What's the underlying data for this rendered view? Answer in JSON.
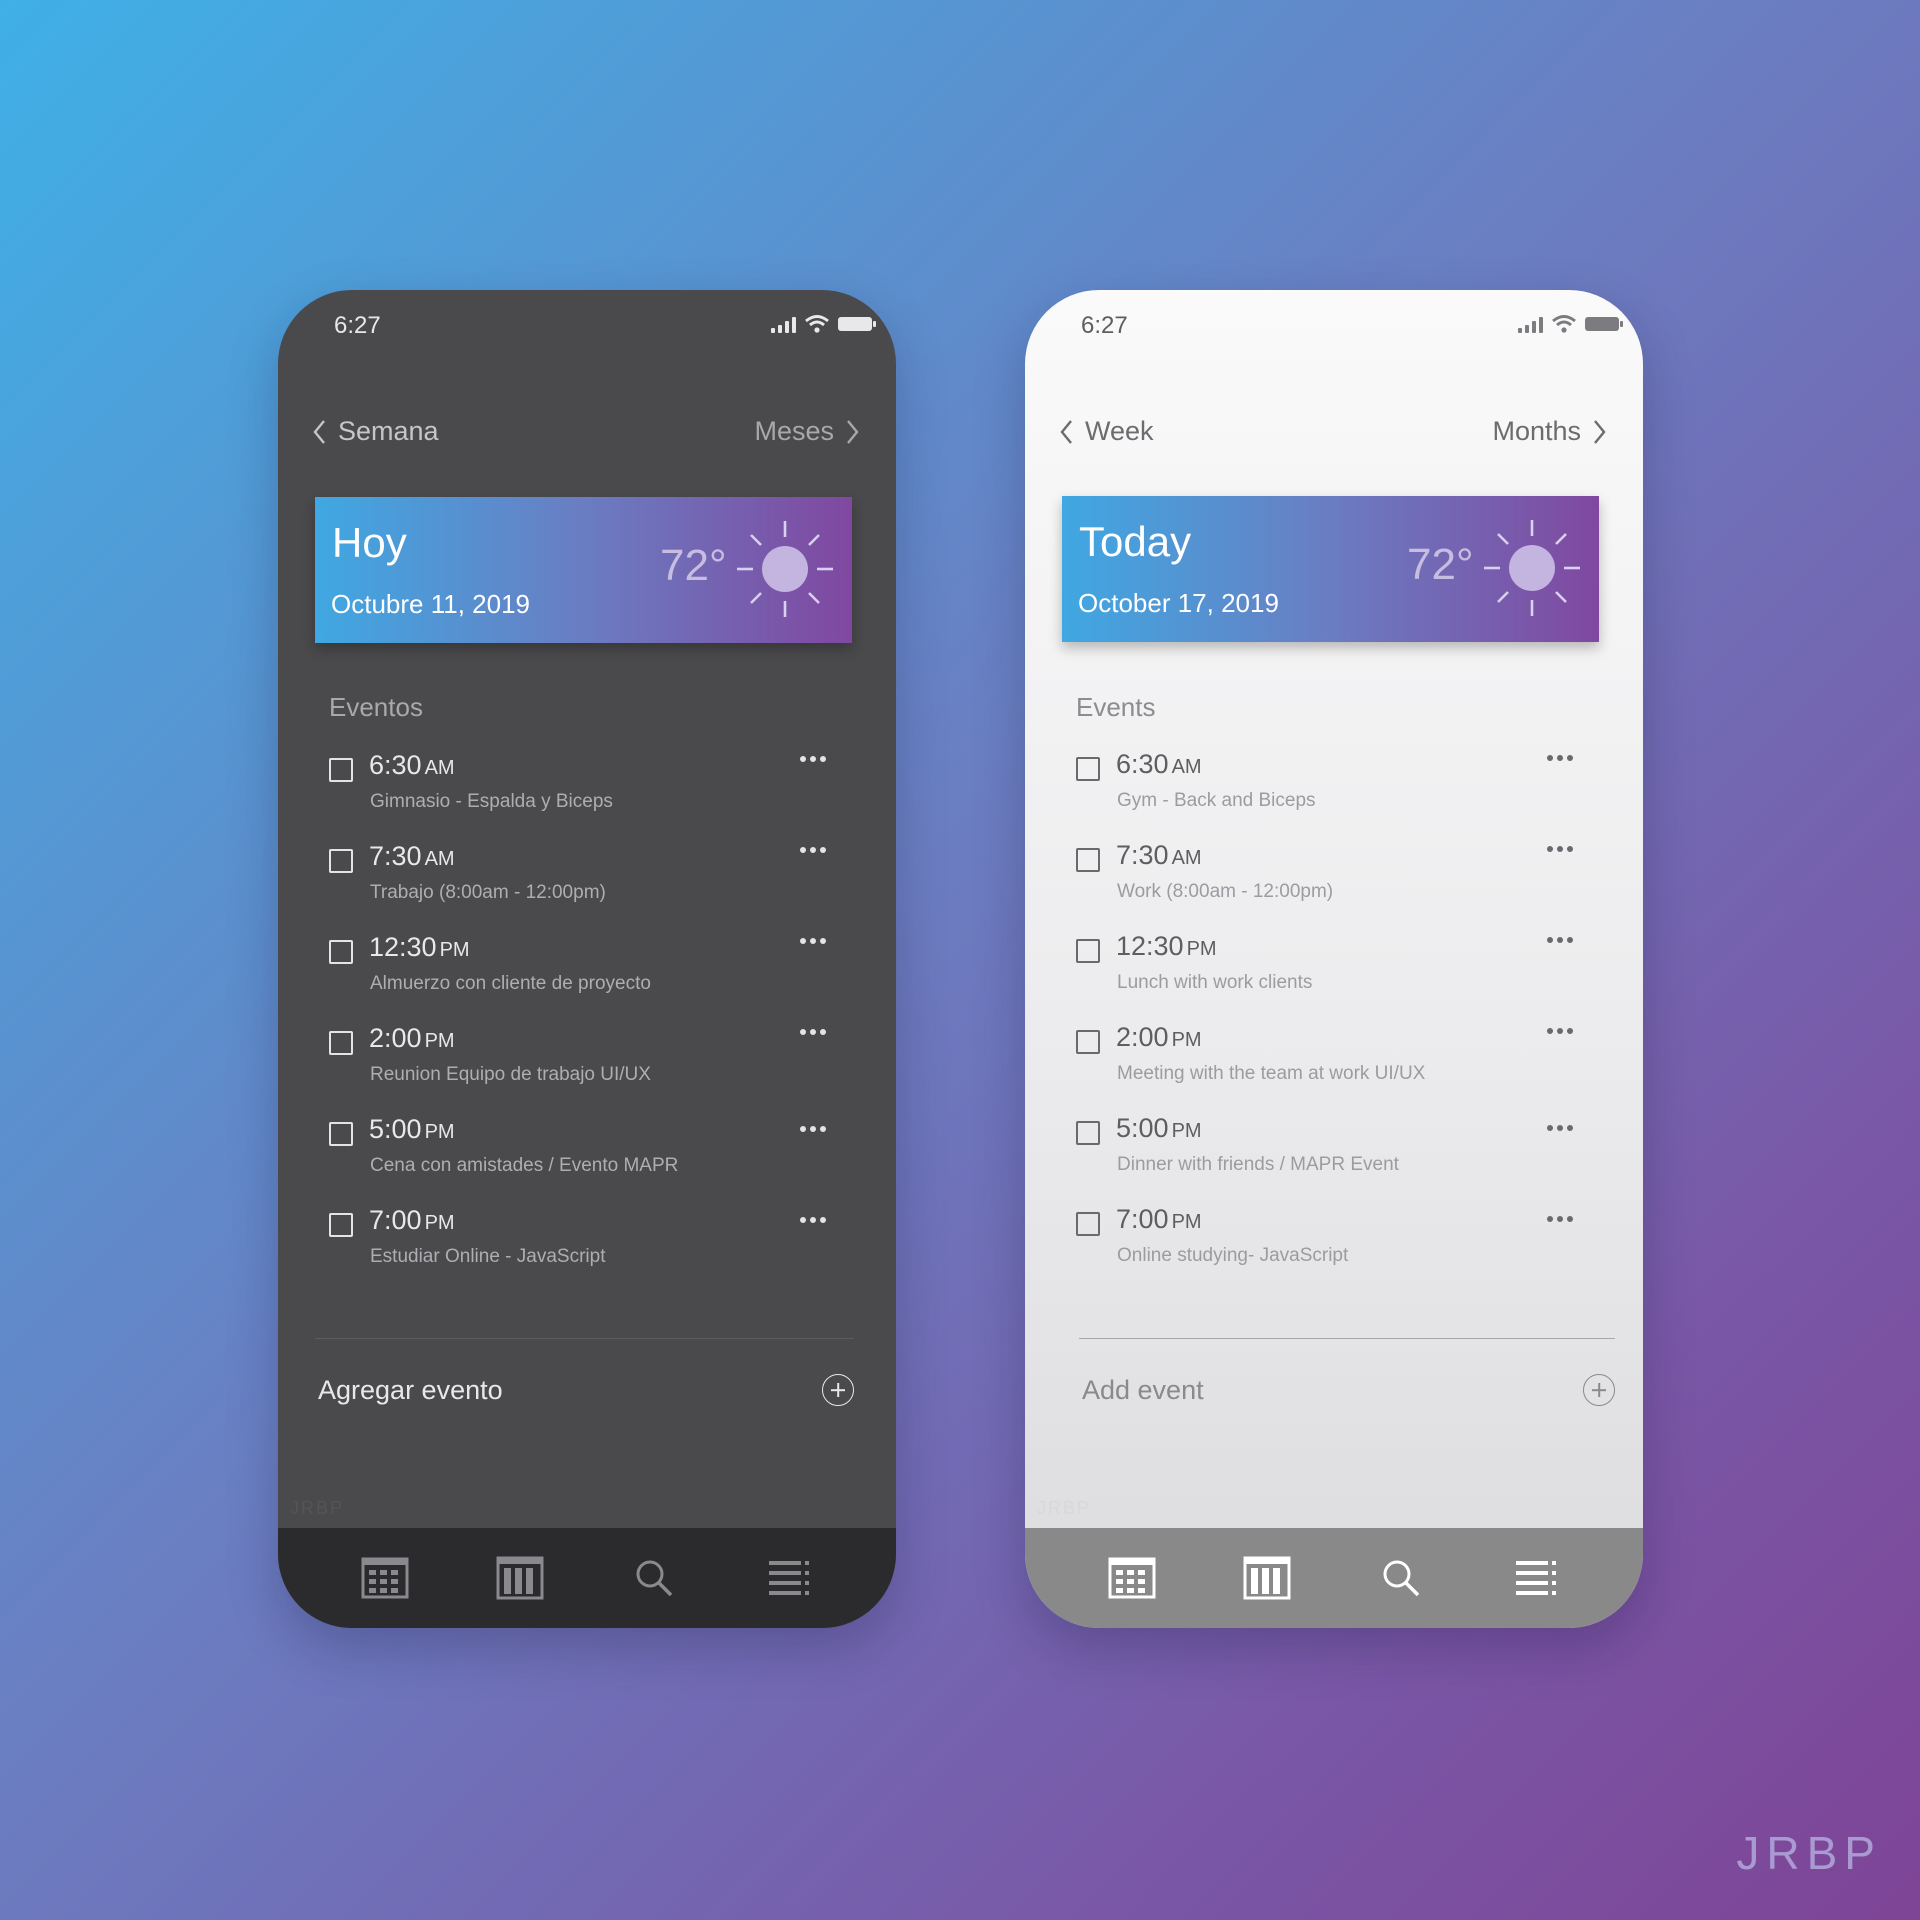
{
  "watermark": "JRBP",
  "phones": [
    {
      "theme": "dark",
      "status_time": "6:27",
      "nav": {
        "back_label": "Semana",
        "forward_label": "Meses"
      },
      "today": {
        "title": "Hoy",
        "date": "Octubre 11, 2019",
        "temperature": "72°",
        "weather_icon": "sun-icon"
      },
      "events_label": "Eventos",
      "events": [
        {
          "time": "6:30",
          "ampm": "AM",
          "desc": "Gimnasio - Espalda y Biceps"
        },
        {
          "time": "7:30",
          "ampm": "AM",
          "desc": "Trabajo (8:00am - 12:00pm)"
        },
        {
          "time": "12:30",
          "ampm": "PM",
          "desc": "Almuerzo con cliente de proyecto"
        },
        {
          "time": "2:00",
          "ampm": "PM",
          "desc": "Reunion Equipo de trabajo UI/UX"
        },
        {
          "time": "5:00",
          "ampm": "PM",
          "desc": "Cena con amistades / Evento MAPR"
        },
        {
          "time": "7:00",
          "ampm": "PM",
          "desc": "Estudiar Online - JavaScript"
        }
      ],
      "add_event_label": "Agregar evento",
      "tabs": [
        "month-grid-icon",
        "week-columns-icon",
        "search-icon",
        "list-icon"
      ]
    },
    {
      "theme": "light",
      "status_time": "6:27",
      "nav": {
        "back_label": "Week",
        "forward_label": "Months"
      },
      "today": {
        "title": "Today",
        "date": "October 17, 2019",
        "temperature": "72°",
        "weather_icon": "sun-icon"
      },
      "events_label": "Events",
      "events": [
        {
          "time": "6:30",
          "ampm": "AM",
          "desc": "Gym - Back and Biceps"
        },
        {
          "time": "7:30",
          "ampm": "AM",
          "desc": "Work (8:00am - 12:00pm)"
        },
        {
          "time": "12:30",
          "ampm": "PM",
          "desc": "Lunch with work clients"
        },
        {
          "time": "2:00",
          "ampm": "PM",
          "desc": "Meeting with the team at work UI/UX"
        },
        {
          "time": "5:00",
          "ampm": "PM",
          "desc": "Dinner with friends / MAPR Event"
        },
        {
          "time": "7:00",
          "ampm": "PM",
          "desc": "Online studying- JavaScript"
        }
      ],
      "add_event_label": "Add event",
      "tabs": [
        "month-grid-icon",
        "week-columns-icon",
        "search-icon",
        "list-icon"
      ]
    }
  ],
  "colors": {
    "background_start": "#3fb0e6",
    "background_end": "#7e4496",
    "card_start": "#3fa8e2",
    "card_end": "#8048a0",
    "dark_phone": "#4a4a4c",
    "dark_tabbar": "#2b2b2d",
    "light_tabbar": "#898989"
  }
}
